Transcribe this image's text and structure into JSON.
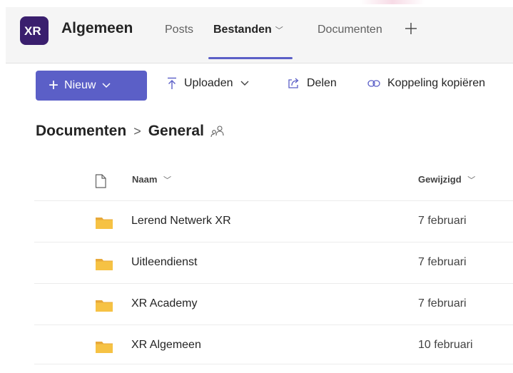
{
  "channel": {
    "title": "Algemeen",
    "tabs": [
      {
        "label": "Posts"
      },
      {
        "label": "Bestanden"
      },
      {
        "label": "Documenten"
      }
    ]
  },
  "toolbar": {
    "new_label": "Nieuw",
    "upload_label": "Uploaden",
    "share_label": "Delen",
    "copy_link_label": "Koppeling kopiëren"
  },
  "breadcrumb": {
    "root": "Documenten",
    "current": "General"
  },
  "table": {
    "columns": {
      "name": "Naam",
      "modified": "Gewijzigd"
    },
    "rows": [
      {
        "name": "Lerend Netwerk XR",
        "modified": "7 februari"
      },
      {
        "name": "Uitleendienst",
        "modified": "7 februari"
      },
      {
        "name": "XR Academy",
        "modified": "7 februari"
      },
      {
        "name": "XR Algemeen",
        "modified": "10 februari"
      }
    ]
  },
  "icons": {
    "team_avatar": "team-logo",
    "add_tab": "plus-icon",
    "upload": "upload-arrow-icon",
    "share": "share-icon",
    "link": "link-icon",
    "shared_people": "people-icon",
    "file_type": "document-icon",
    "folder": "folder-icon"
  },
  "colors": {
    "accent": "#5b5fc7",
    "folder": "#f6c244",
    "team_avatar_bg": "#3a1f6e"
  }
}
